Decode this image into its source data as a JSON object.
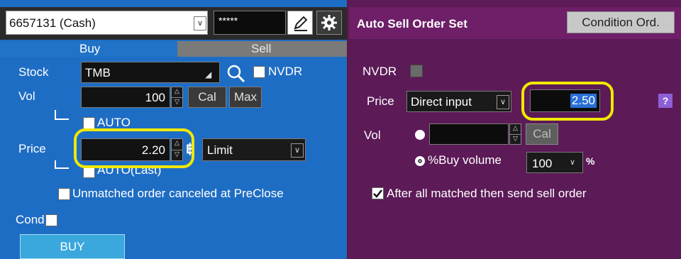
{
  "account": {
    "selected": "6657131 (Cash)",
    "password_mask": "*****"
  },
  "tabs": {
    "buy": "Buy",
    "sell": "Sell"
  },
  "left": {
    "stock_label": "Stock",
    "stock_value": "TMB",
    "nvdr_label": "NVDR",
    "vol_label": "Vol",
    "vol_value": "100",
    "cal_label": "Cal",
    "max_label": "Max",
    "auto_label": "AUTO",
    "price_label": "Price",
    "price_value": "2.20",
    "currency_symbol": "฿",
    "order_type": "Limit",
    "auto_last_label": "AUTO(Last)",
    "unmatched_label": "Unmatched order canceled at PreClose",
    "cond_label": "Cond",
    "buy_button": "BUY"
  },
  "right": {
    "title": "Auto Sell Order Set",
    "condition_button": "Condition Ord.",
    "nvdr_label": "NVDR",
    "price_label": "Price",
    "price_mode": "Direct input",
    "price_value": "2.50",
    "help_label": "?",
    "vol_label": "Vol",
    "cal_label": "Cal",
    "buy_volume_label": "%Buy volume",
    "buy_volume_value": "100",
    "percent_label": "%",
    "after_matched_label": "After all matched then send sell order"
  },
  "colors": {
    "left_panel": "#1e6dc4",
    "right_panel": "#5c1a57",
    "highlight": "#f0e800",
    "buy_button": "#3aa8dc"
  }
}
